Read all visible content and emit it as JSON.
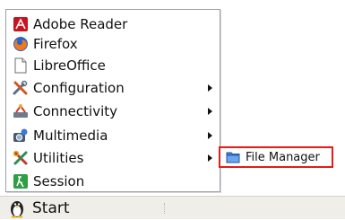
{
  "menu": {
    "items": [
      {
        "label": "Adobe Reader",
        "icon": "adobe-reader-icon",
        "has_submenu": false
      },
      {
        "label": "Firefox",
        "icon": "firefox-icon",
        "has_submenu": false
      },
      {
        "label": "LibreOffice",
        "icon": "libreoffice-icon",
        "has_submenu": false
      },
      {
        "label": "Configuration",
        "icon": "tools-icon",
        "has_submenu": true
      },
      {
        "label": "Connectivity",
        "icon": "connectivity-icon",
        "has_submenu": true
      },
      {
        "label": "Multimedia",
        "icon": "multimedia-icon",
        "has_submenu": true
      },
      {
        "label": "Utilities",
        "icon": "utilities-icon",
        "has_submenu": true
      },
      {
        "label": "Session",
        "icon": "session-icon",
        "has_submenu": false
      }
    ]
  },
  "submenu": {
    "items": [
      {
        "label": "File Manager",
        "icon": "folder-icon"
      }
    ],
    "highlight_color": "#e41b17"
  },
  "taskbar": {
    "start_label": "Start",
    "start_icon": "penguin-icon"
  }
}
